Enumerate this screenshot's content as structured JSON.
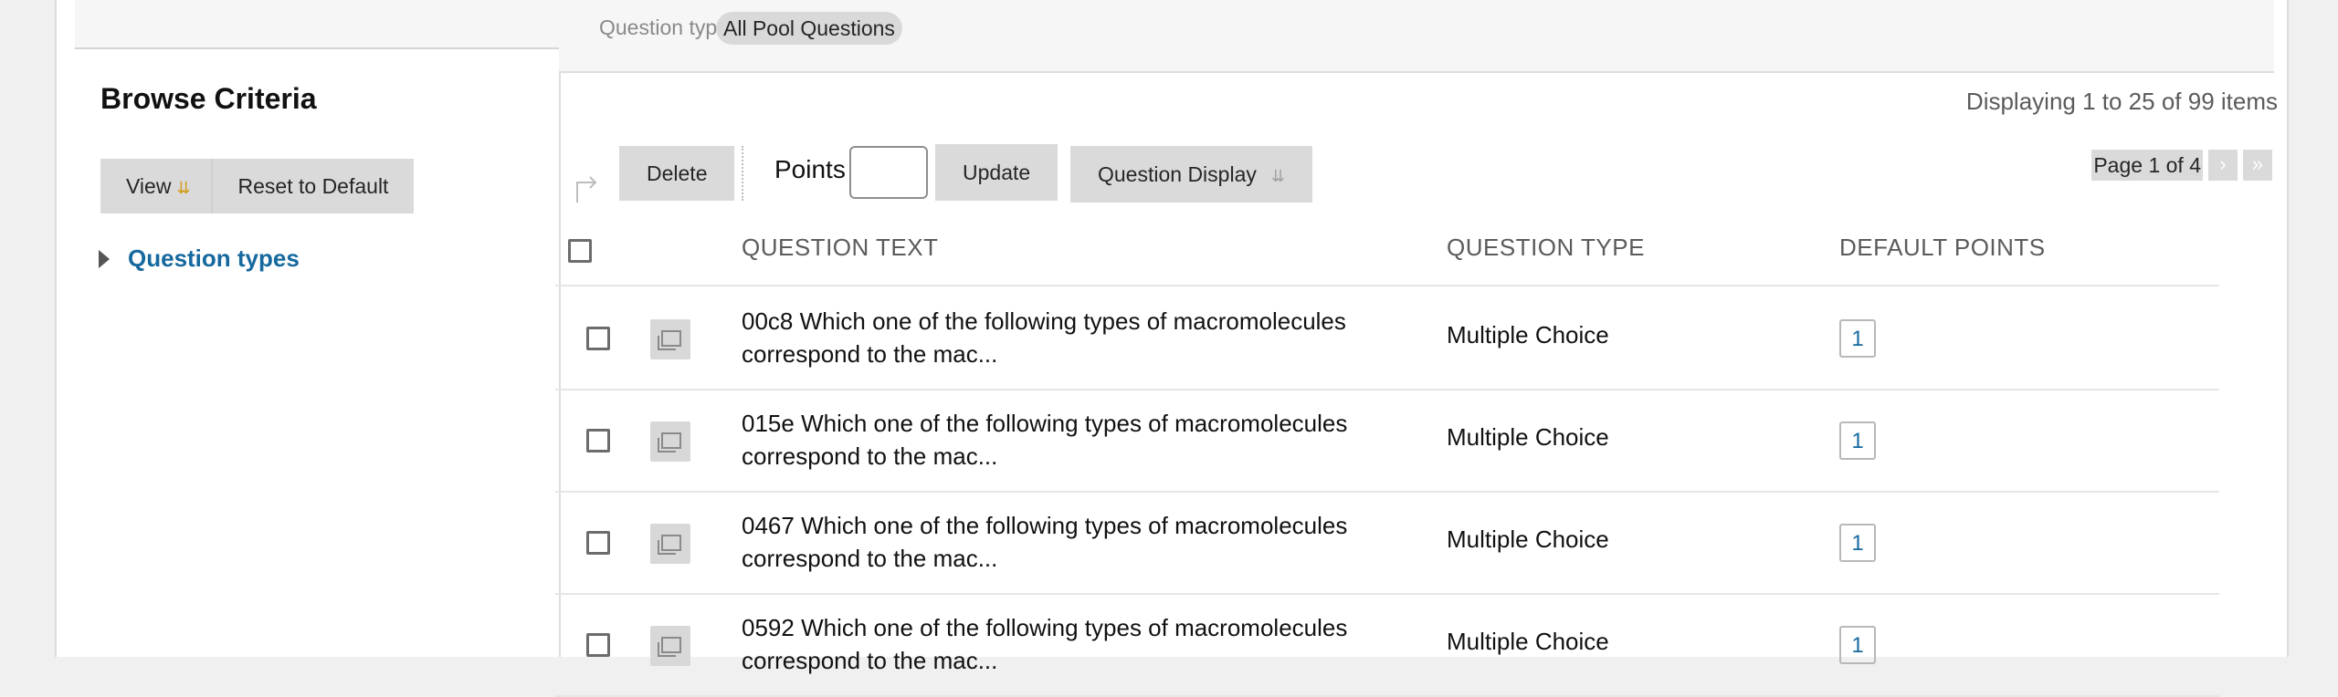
{
  "filter": {
    "label": "Question types",
    "chip": "All Pool Questions"
  },
  "sidebar": {
    "title": "Browse Criteria",
    "view_label": "View",
    "reset_label": "Reset to Default",
    "question_types_link": "Question types"
  },
  "main": {
    "display_count": "Displaying 1 to 25 of 99 items",
    "toolbar": {
      "delete_label": "Delete",
      "points_label": "Points",
      "points_value": "",
      "update_label": "Update",
      "question_display_label": "Question Display"
    },
    "pager": {
      "text": "Page 1 of 4",
      "next_icon": "chevron-right-icon",
      "last_icon": "double-chevron-right-icon"
    },
    "table": {
      "headers": {
        "question_text": "QUESTION TEXT",
        "question_type": "QUESTION TYPE",
        "default_points": "DEFAULT POINTS"
      },
      "rows": [
        {
          "text": "00c8 Which one of the following types of macromolecules correspond to the mac...",
          "type": "Multiple Choice",
          "points": "1"
        },
        {
          "text": "015e Which one of the following types of macromolecules correspond to the mac...",
          "type": "Multiple Choice",
          "points": "1"
        },
        {
          "text": "0467 Which one of the following types of macromolecules correspond to the mac...",
          "type": "Multiple Choice",
          "points": "1"
        },
        {
          "text": "0592 Which one of the following types of macromolecules correspond to the mac...",
          "type": "Multiple Choice",
          "points": "1"
        }
      ]
    }
  },
  "colors": {
    "link": "#16699e",
    "accent_chevron": "#d19b16"
  }
}
